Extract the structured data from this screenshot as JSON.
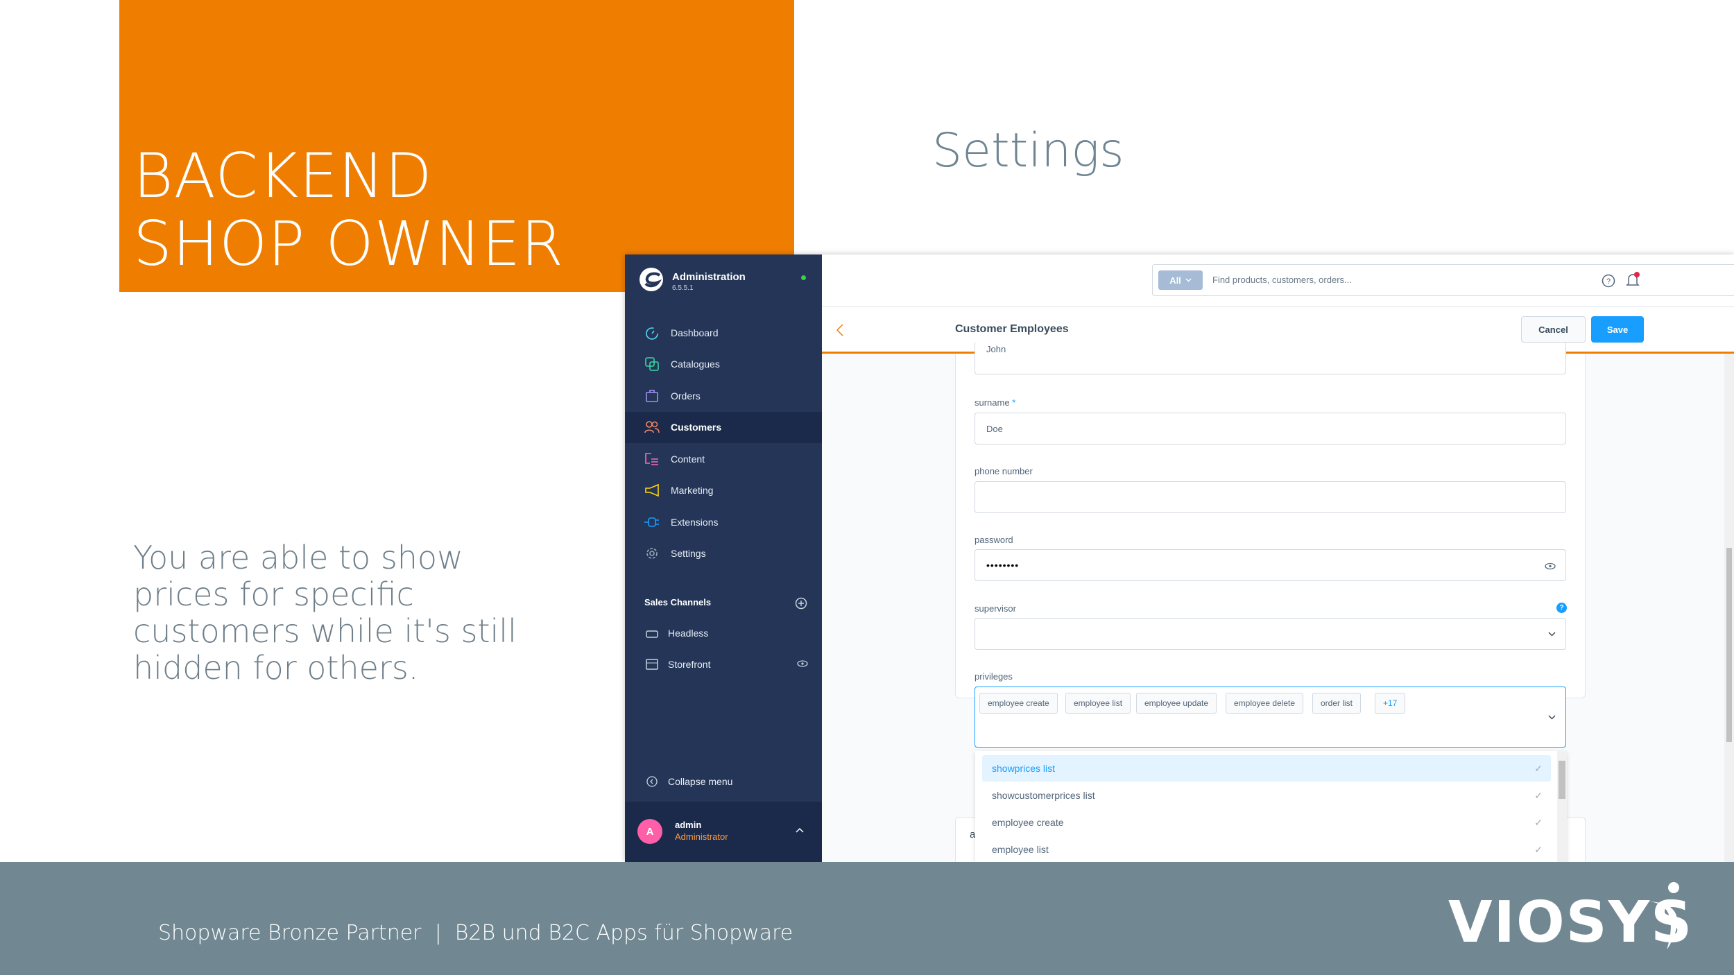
{
  "slide": {
    "hero_title": "BACKEND\nSHOP OWNER",
    "section_title": "Settings",
    "description": "You are able to show prices for specific customers while it's still hidden for others.",
    "footer_text": "Shopware Bronze Partner  |  B2B und B2C Apps für Shopware",
    "logo_text": "VIOSYS",
    "colors": {
      "accent": "#ef7d00",
      "footer": "#718893",
      "sidebar": "#243558",
      "primary": "#189eff"
    }
  },
  "admin": {
    "app_title": "Administration",
    "version": "6.5.5.1",
    "nav": [
      {
        "label": "Dashboard",
        "icon": "gauge-icon",
        "color": "#57d9f5"
      },
      {
        "label": "Catalogues",
        "icon": "catalogue-icon",
        "color": "#37d69f"
      },
      {
        "label": "Orders",
        "icon": "shopping-bag-icon",
        "color": "#a092f0"
      },
      {
        "label": "Customers",
        "icon": "users-icon",
        "color": "#f88962",
        "active": true
      },
      {
        "label": "Content",
        "icon": "content-icon",
        "color": "#ff68b4"
      },
      {
        "label": "Marketing",
        "icon": "megaphone-icon",
        "color": "#ffd700"
      },
      {
        "label": "Extensions",
        "icon": "plug-icon",
        "color": "#189eff"
      },
      {
        "label": "Settings",
        "icon": "gear-icon",
        "color": "#9aa8b5"
      }
    ],
    "sales_channels": {
      "title": "Sales Channels",
      "items": [
        {
          "label": "Headless",
          "icon": "basket-icon"
        },
        {
          "label": "Storefront",
          "icon": "storefront-icon"
        }
      ]
    },
    "collapse_label": "Collapse menu",
    "user": {
      "initial": "A",
      "name": "admin",
      "role": "Administrator"
    },
    "search": {
      "scope": "All",
      "placeholder": "Find products, customers, orders..."
    },
    "page_title": "Customer Employees",
    "cancel_label": "Cancel",
    "save_label": "Save",
    "form": {
      "first_name_value": "John",
      "surname_label": "surname",
      "surname_required": "*",
      "surname_value": "Doe",
      "phone_label": "phone number",
      "phone_value": "",
      "password_label": "password",
      "password_value": "••••••••",
      "supervisor_label": "supervisor",
      "supervisor_value": "",
      "privileges_label": "privileges",
      "privilege_tags": [
        "employee create",
        "employee list",
        "employee update",
        "employee delete",
        "order list"
      ],
      "more_tags": "+17",
      "options": [
        "showprices list",
        "showcustomerprices list",
        "employee create",
        "employee list"
      ],
      "next_card_letter": "a"
    }
  }
}
